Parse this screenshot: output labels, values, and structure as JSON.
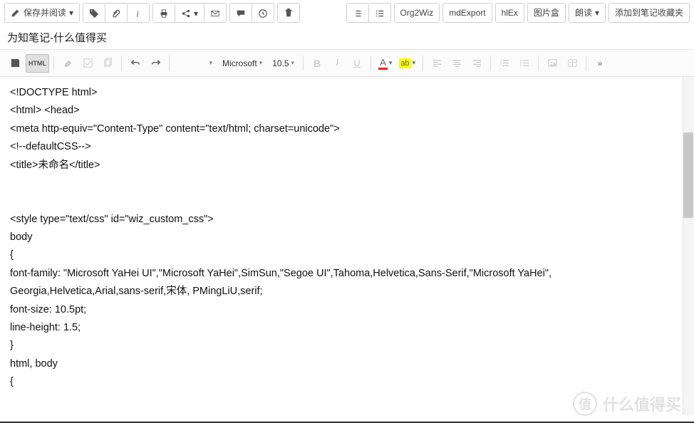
{
  "toolbar": {
    "save_read": "保存并阅读",
    "plugins": {
      "org2wiz": "Org2Wiz",
      "mdexport": "mdExport",
      "hlex": "hlEx",
      "imgbox": "图片盒"
    },
    "read_aloud": "朗读",
    "add_fav": "添加到笔记收藏夹"
  },
  "title": "为知笔记-什么值得买",
  "editor": {
    "html_btn": "HTML",
    "font_family": "Microsoft",
    "font_size": "10.5",
    "font_color_letter": "A",
    "highlight_letter": "ab"
  },
  "content_lines": [
    "<!DOCTYPE html>",
    "<html> <head>",
    "<meta http-equiv=\"Content-Type\" content=\"text/html; charset=unicode\">",
    "<!--defaultCSS-->",
    "<title>未命名</title>",
    "",
    "",
    "<style type=\"text/css\" id=\"wiz_custom_css\">",
    "body",
    "{",
    "    font-family: \"Microsoft YaHei UI\",\"Microsoft YaHei\",SimSun,\"Segoe UI\",Tahoma,Helvetica,Sans-Serif,\"Microsoft YaHei\",",
    "Georgia,Helvetica,Arial,sans-serif,宋体, PMingLiU,serif;",
    "    font-size: 10.5pt;",
    "    line-height: 1.5;",
    "}",
    "html, body",
    "{"
  ],
  "watermark": {
    "icon": "值",
    "text": "什么值得买"
  }
}
